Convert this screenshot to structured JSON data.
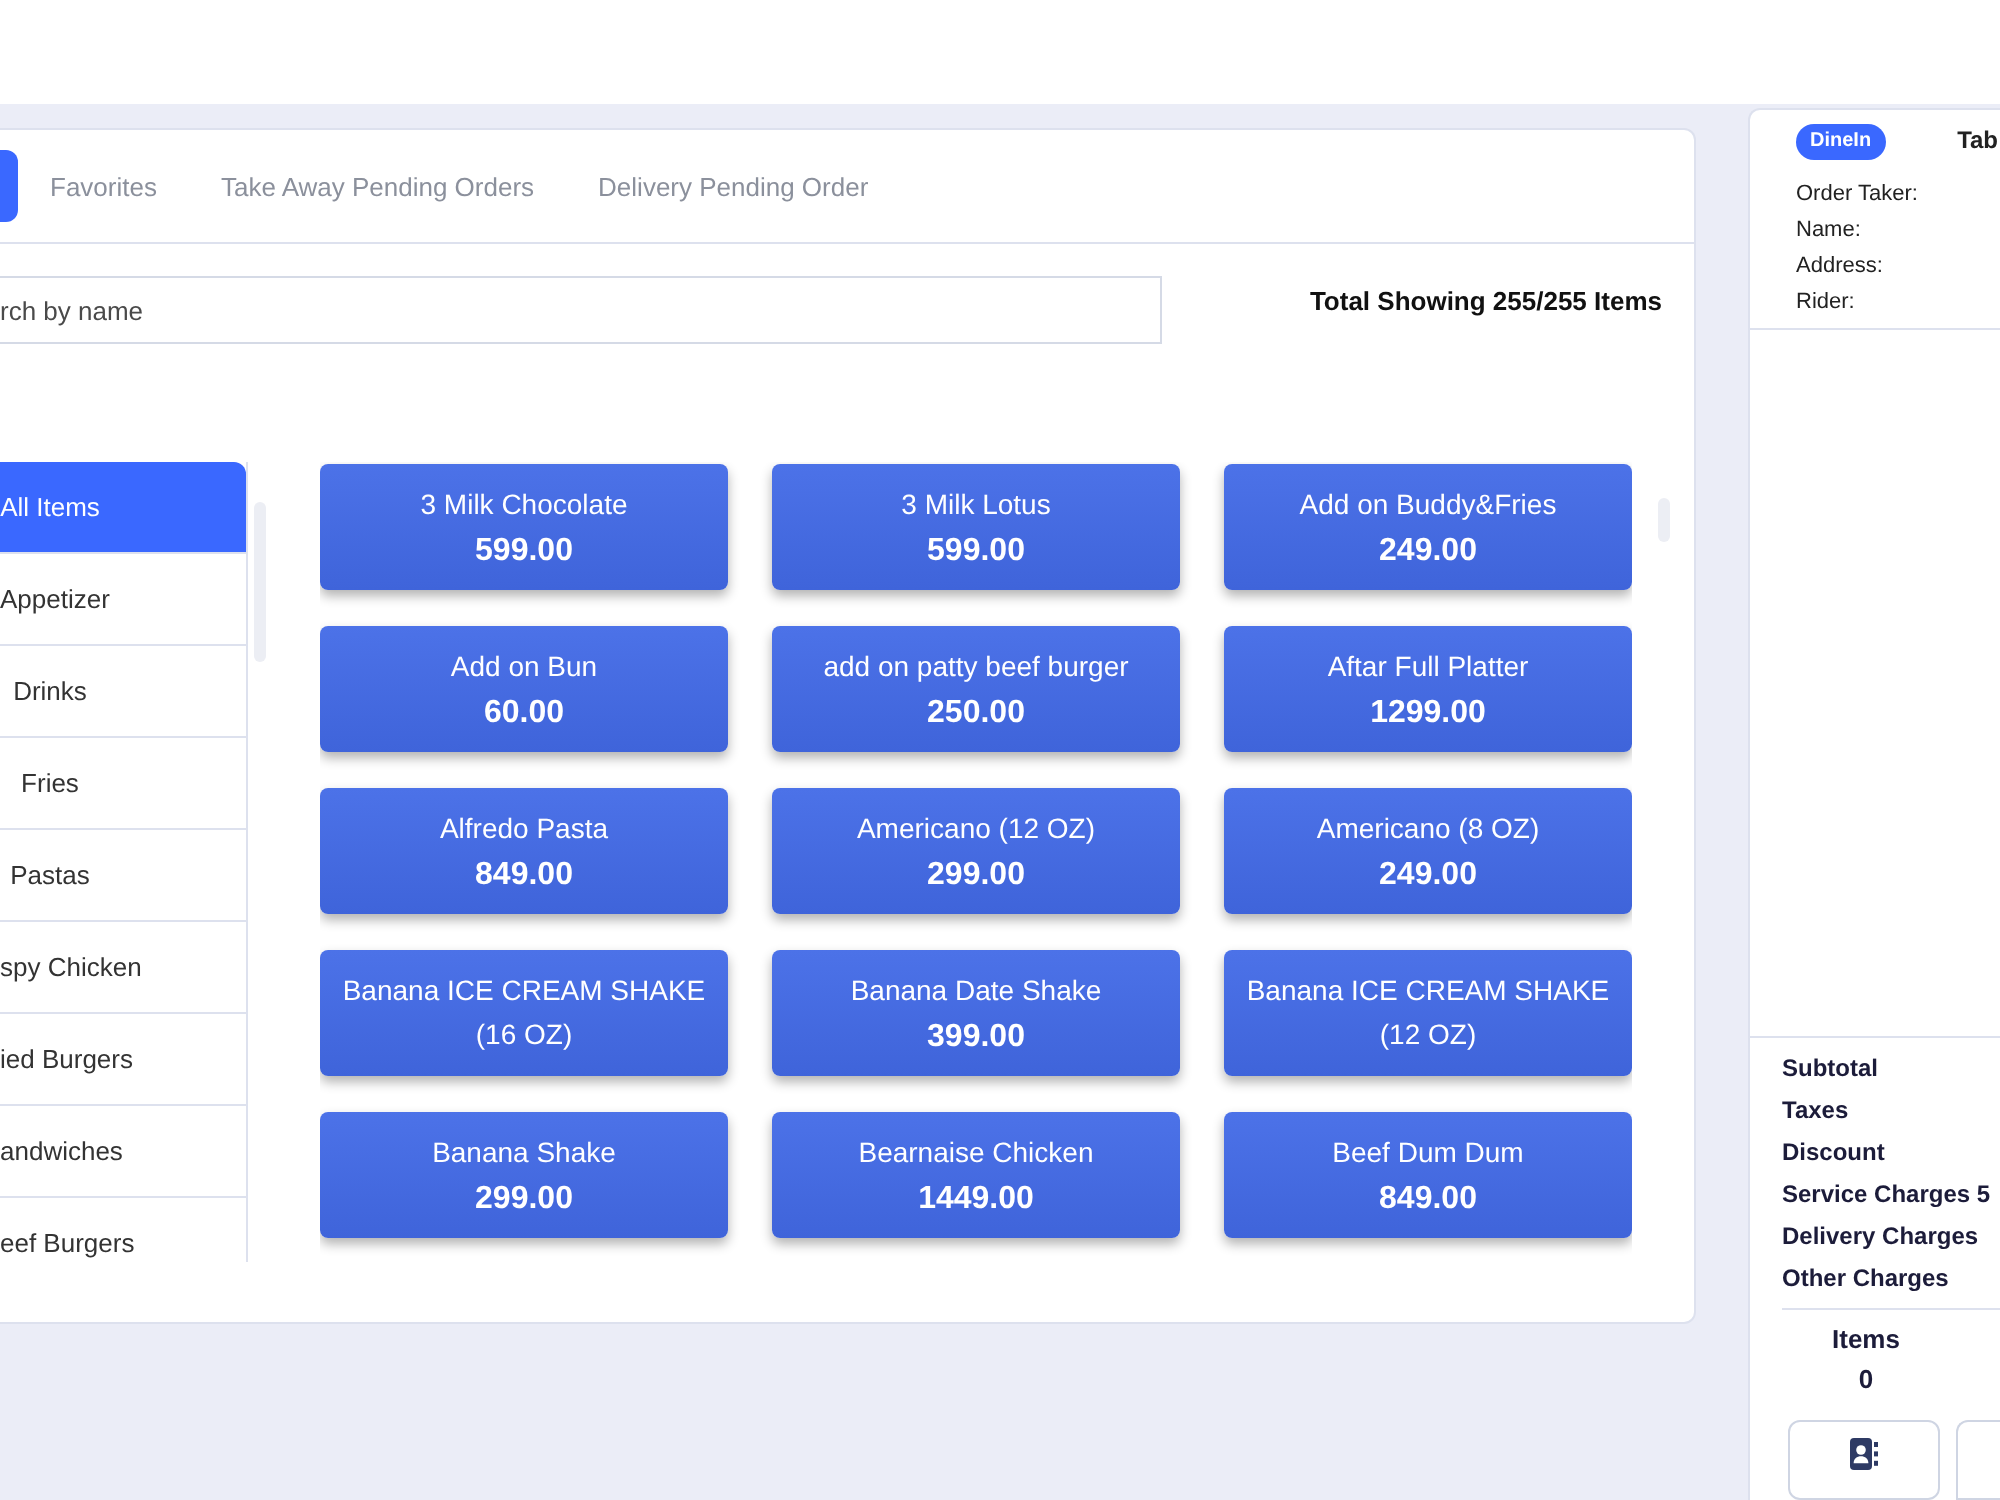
{
  "tabs": [
    {
      "selected": true
    },
    {
      "label": "Favorites",
      "selected": false
    },
    {
      "label": "Take Away Pending Orders",
      "selected": false
    },
    {
      "label": "Delivery Pending Order",
      "selected": false
    }
  ],
  "search": {
    "placeholder": "rch by name"
  },
  "total_showing": "Total Showing 255/255 Items",
  "categories": [
    {
      "label": "All Items",
      "selected": true
    },
    {
      "label": "Appetizer",
      "selected": false
    },
    {
      "label": "Drinks",
      "selected": false
    },
    {
      "label": "Fries",
      "selected": false
    },
    {
      "label": "Pastas",
      "selected": false
    },
    {
      "label": "spy Chicken",
      "selected": false
    },
    {
      "label": "ied Burgers",
      "selected": false
    },
    {
      "label": "andwiches",
      "selected": false
    },
    {
      "label": "eef Burgers",
      "selected": false
    }
  ],
  "menu_items": [
    {
      "name": "3 Milk Chocolate",
      "price": "599.00"
    },
    {
      "name": "3 Milk Lotus",
      "price": "599.00"
    },
    {
      "name": "Add on Buddy&Fries",
      "price": "249.00"
    },
    {
      "name": "Add on Bun",
      "price": "60.00"
    },
    {
      "name": "add on patty beef burger",
      "price": "250.00"
    },
    {
      "name": "Aftar Full Platter",
      "price": "1299.00"
    },
    {
      "name": "Alfredo Pasta",
      "price": "849.00"
    },
    {
      "name": "Americano (12 OZ)",
      "price": "299.00"
    },
    {
      "name": "Americano (8 OZ)",
      "price": "249.00"
    },
    {
      "name": "Banana ICE CREAM SHAKE (16 OZ)"
    },
    {
      "name": "Banana Date Shake",
      "price": "399.00"
    },
    {
      "name": "Banana ICE CREAM SHAKE (12 OZ)"
    },
    {
      "name": "Banana Shake",
      "price": "299.00"
    },
    {
      "name": "Bearnaise Chicken",
      "price": "1449.00"
    },
    {
      "name": "Beef Dum Dum",
      "price": "849.00"
    }
  ],
  "order_panel": {
    "order_type": "DineIn",
    "table_label": "Tab",
    "fields": [
      "Order Taker:",
      "Name:",
      "Address:",
      "Rider:"
    ],
    "totals": [
      "Subtotal",
      "Taxes",
      "Discount",
      "Service Charges 5",
      "Delivery Charges",
      "Other Charges"
    ],
    "items_label": "Items",
    "items_count": "0",
    "actions": [
      {
        "kind": "contact-book"
      },
      {
        "kind": "empty"
      }
    ]
  }
}
